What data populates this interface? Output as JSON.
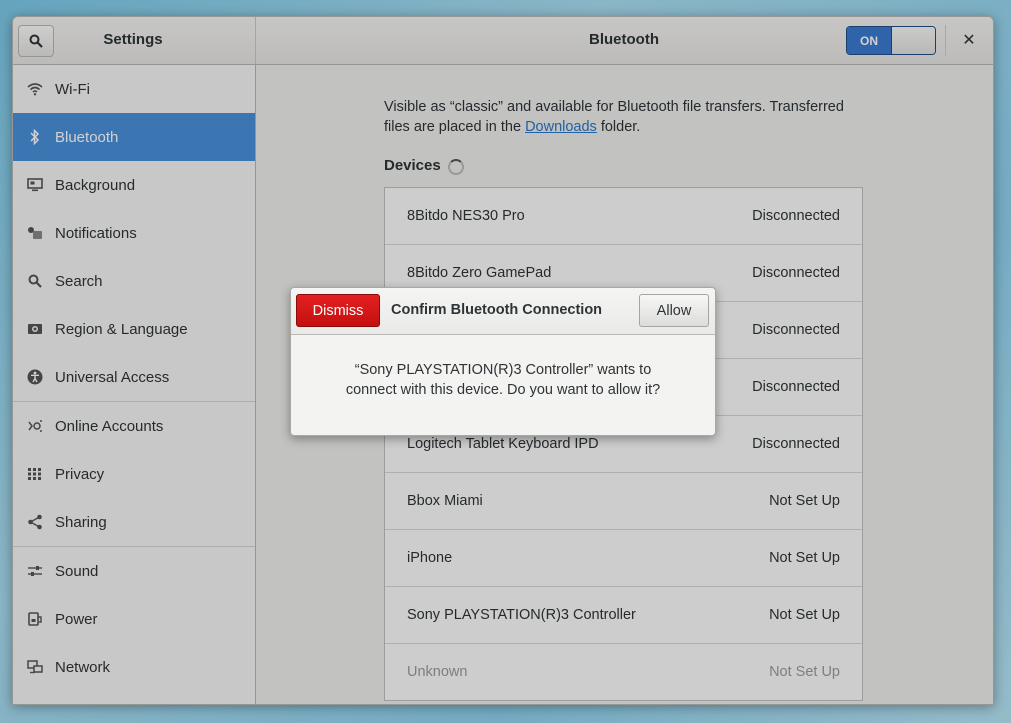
{
  "header": {
    "left_title": "Settings",
    "main_title": "Bluetooth",
    "toggle_on": "ON"
  },
  "sidebar": {
    "items": [
      {
        "label": "Wi-Fi",
        "icon": "wifi-icon"
      },
      {
        "label": "Bluetooth",
        "icon": "bluetooth-icon",
        "selected": true
      },
      {
        "label": "Background",
        "icon": "background-icon"
      },
      {
        "label": "Notifications",
        "icon": "notifications-icon"
      },
      {
        "label": "Search",
        "icon": "search-icon"
      },
      {
        "label": "Region & Language",
        "icon": "region-icon"
      },
      {
        "label": "Universal Access",
        "icon": "accessibility-icon"
      },
      {
        "label": "Online Accounts",
        "icon": "online-accounts-icon"
      },
      {
        "label": "Privacy",
        "icon": "privacy-icon"
      },
      {
        "label": "Sharing",
        "icon": "sharing-icon"
      },
      {
        "label": "Sound",
        "icon": "sound-icon"
      },
      {
        "label": "Power",
        "icon": "power-icon"
      },
      {
        "label": "Network",
        "icon": "network-icon"
      }
    ]
  },
  "content": {
    "desc_before": "Visible as “classic” and available for Bluetooth file transfers. Transferred files are placed in the ",
    "desc_link": "Downloads",
    "desc_after": " folder.",
    "devices_label": "Devices",
    "devices": [
      {
        "name": "8Bitdo NES30 Pro",
        "status": "Disconnected"
      },
      {
        "name": "8Bitdo Zero GamePad",
        "status": "Disconnected"
      },
      {
        "name": "",
        "status": "Disconnected"
      },
      {
        "name": "",
        "status": "Disconnected"
      },
      {
        "name": "Logitech Tablet Keyboard IPD",
        "status": "Disconnected"
      },
      {
        "name": "Bbox Miami",
        "status": "Not Set Up"
      },
      {
        "name": "iPhone",
        "status": "Not Set Up"
      },
      {
        "name": "Sony PLAYSTATION(R)3 Controller",
        "status": "Not Set Up"
      },
      {
        "name": "Unknown",
        "status": "Not Set Up"
      }
    ]
  },
  "dialog": {
    "dismiss": "Dismiss",
    "title": "Confirm Bluetooth Connection",
    "allow": "Allow",
    "line1": "“Sony PLAYSTATION(R)3 Controller” wants to",
    "line2": "connect with this device. Do you want to allow it?"
  }
}
